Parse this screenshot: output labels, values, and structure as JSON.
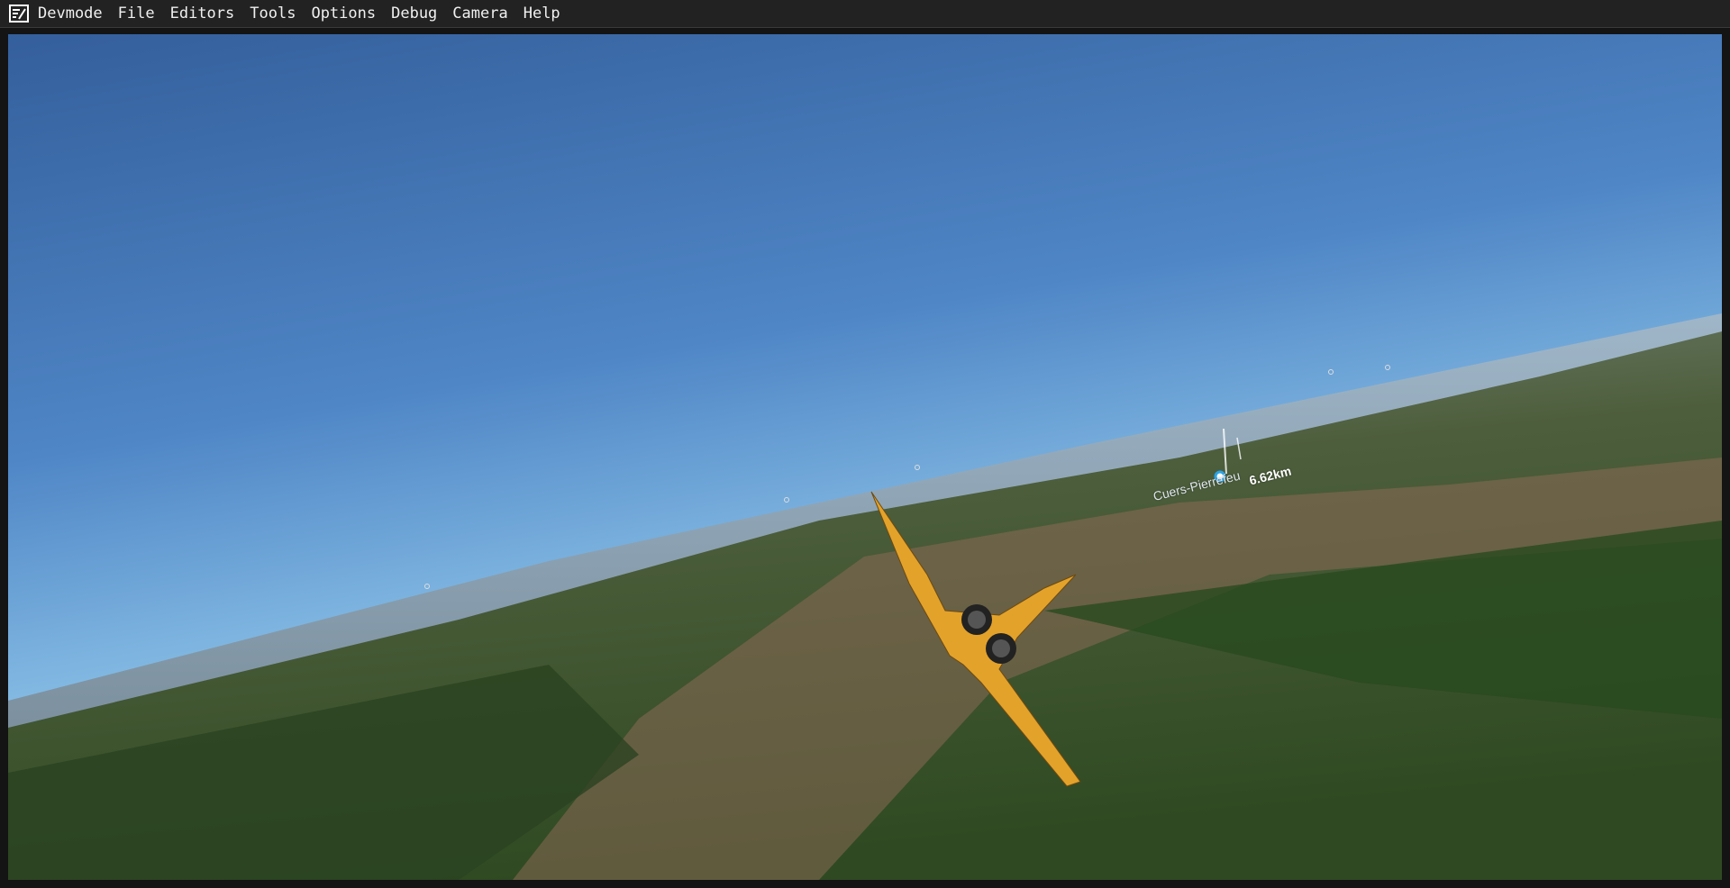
{
  "menubar": {
    "logo_icon": "devmode-logo-icon",
    "items": [
      "Devmode",
      "File",
      "Editors",
      "Tools",
      "Options",
      "Debug",
      "Camera",
      "Help"
    ]
  },
  "scene": {
    "poi_name": "Cuers-Pierrefeu",
    "poi_distance": "6.62km"
  }
}
